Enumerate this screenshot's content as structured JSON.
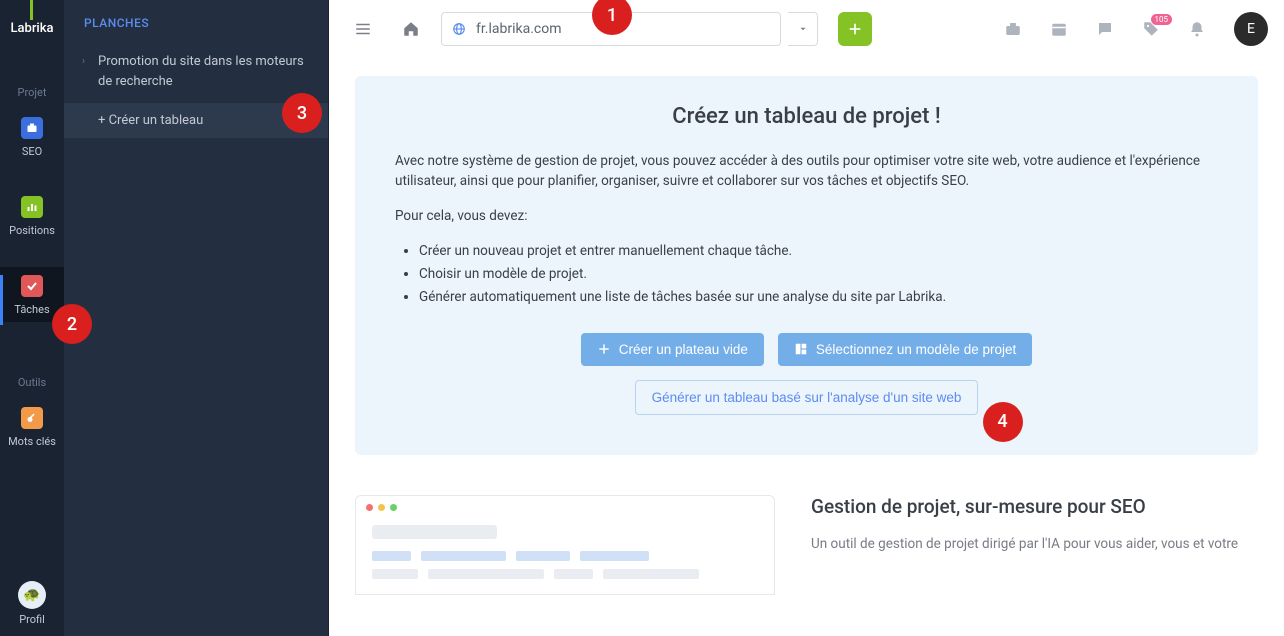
{
  "brand": "Labrika",
  "rail": {
    "section1": "Projet",
    "seo": "SEO",
    "positions": "Positions",
    "tasks": "Tâches",
    "section2": "Outils",
    "keywords": "Mots clés",
    "profile": "Profil"
  },
  "sidebar": {
    "header": "PLANCHES",
    "item1": "Promotion du site dans les moteurs de recherche",
    "create": "+ Créer un tableau"
  },
  "topbar": {
    "url": "fr.labrika.com",
    "tag_badge": "105",
    "user_initial": "E"
  },
  "card": {
    "title": "Créez un tableau de projet !",
    "p1": "Avec notre système de gestion de projet, vous pouvez accéder à des outils pour optimiser votre site web, votre audience et l'expérience utilisateur, ainsi que pour planifier, organiser, suivre et collaborer sur vos tâches et objectifs SEO.",
    "p2": "Pour cela, vous devez:",
    "li1": "Créer un nouveau projet et entrer manuellement chaque tâche.",
    "li2": "Choisir un modèle de projet.",
    "li3": "Générer automatiquement une liste de tâches basée sur une analyse du site par Labrika.",
    "btn1": "Créer un plateau vide",
    "btn2": "Sélectionnez un modèle de projet",
    "btn3": "Générer un tableau basé sur l'analyse d'un site web"
  },
  "section2": {
    "title": "Gestion de projet, sur-mesure pour SEO",
    "p": "Un outil de gestion de projet dirigé par l'IA pour vous aider, vous et votre"
  },
  "markers": {
    "m1": "1",
    "m2": "2",
    "m3": "3",
    "m4": "4"
  }
}
